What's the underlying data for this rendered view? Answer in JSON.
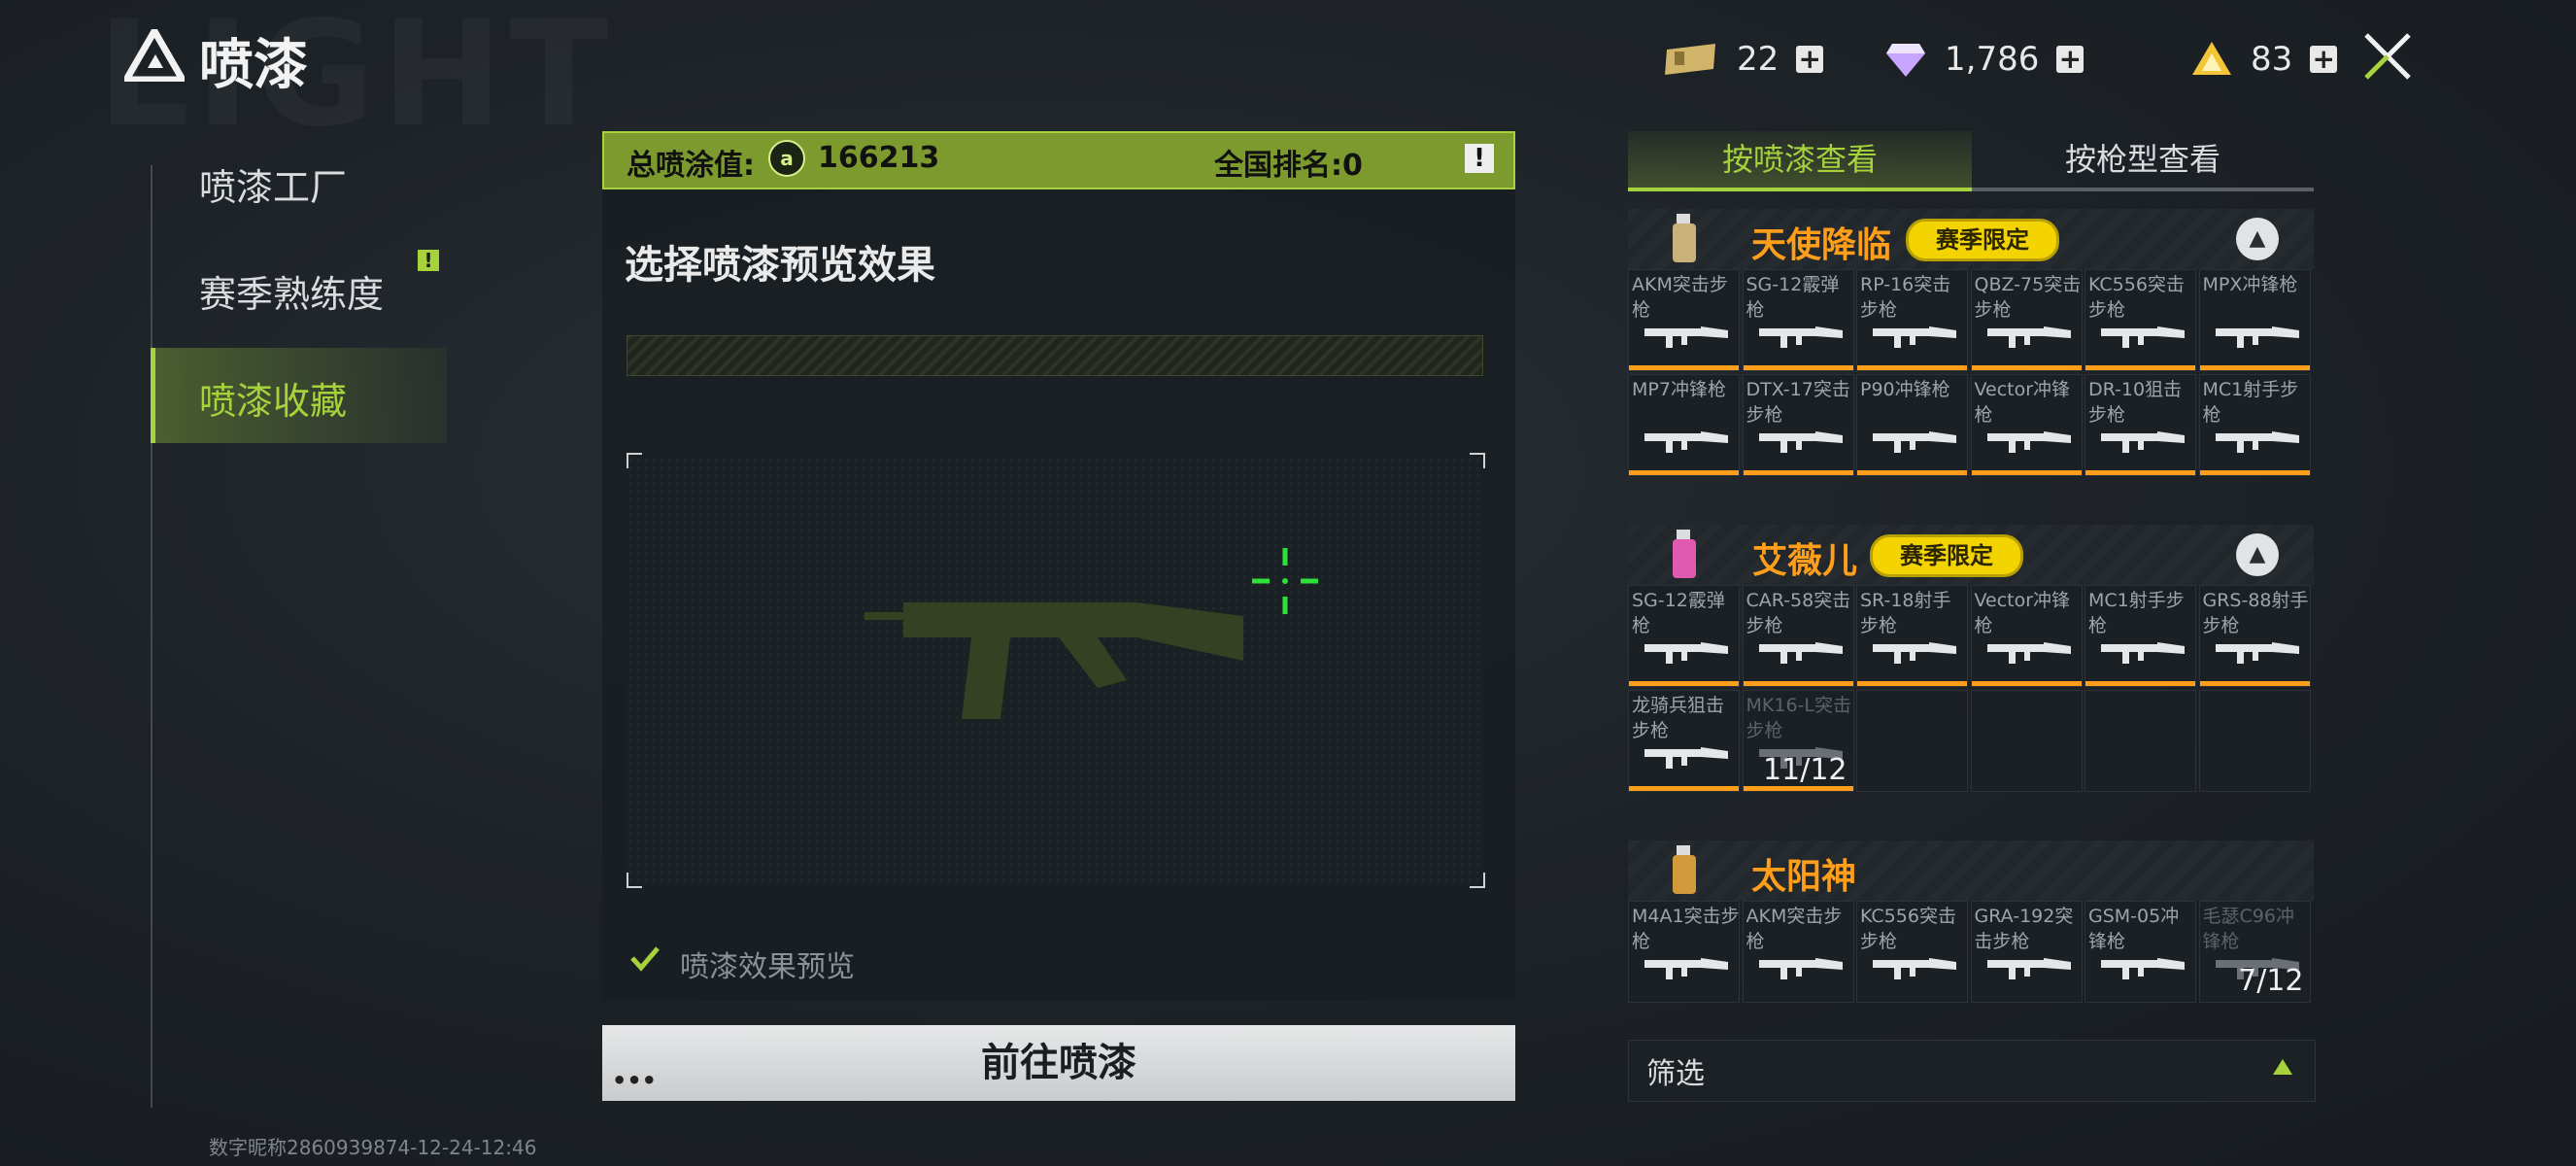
{
  "header": {
    "title": "喷漆",
    "watermark": "LIGHT",
    "currencies": [
      {
        "icon": "ticket-icon",
        "value": "22"
      },
      {
        "icon": "diamond-icon",
        "value": "1,786"
      },
      {
        "icon": "triangle-coin-icon",
        "value": "83"
      }
    ]
  },
  "nav": {
    "items": [
      {
        "label": "喷漆工厂"
      },
      {
        "label": "赛季熟练度",
        "badge": "!"
      },
      {
        "label": "喷漆收藏",
        "active": true
      }
    ]
  },
  "footer": {
    "text": "数字昵称2860939874-12-24-12:46"
  },
  "mid": {
    "header_label": "总喷涂值:",
    "total_value": "166213",
    "rank_label": "全国排名:0",
    "info": "!",
    "title": "选择喷漆预览效果",
    "checkbox_label": "喷漆效果预览",
    "go_button": "前往喷漆",
    "go_dots": "•••"
  },
  "right": {
    "tabs": [
      {
        "label": "按喷漆查看",
        "active": true
      },
      {
        "label": "按枪型查看",
        "active": false
      }
    ],
    "groups": [
      {
        "name": "天使降临",
        "badge": "赛季限定",
        "collapse": "▲",
        "rows": [
          [
            {
              "name": "AKM突击步枪"
            },
            {
              "name": "SG-12霰弹枪"
            },
            {
              "name": "RP-16突击步枪"
            },
            {
              "name": "QBZ-75突击步枪"
            },
            {
              "name": "KC556突击步枪"
            },
            {
              "name": "MPX冲锋枪"
            }
          ],
          [
            {
              "name": "MP7冲锋枪"
            },
            {
              "name": "DTX-17突击步枪"
            },
            {
              "name": "P90冲锋枪"
            },
            {
              "name": "Vector冲锋枪"
            },
            {
              "name": "DR-10狙击步枪"
            },
            {
              "name": "MC1射手步枪"
            }
          ]
        ]
      },
      {
        "name": "艾薇儿",
        "badge": "赛季限定",
        "collapse": "▲",
        "rows": [
          [
            {
              "name": "SG-12霰弹枪"
            },
            {
              "name": "CAR-58突击步枪"
            },
            {
              "name": "SR-18射手步枪"
            },
            {
              "name": "Vector冲锋枪"
            },
            {
              "name": "MC1射手步枪"
            },
            {
              "name": "GRS-88射手步枪"
            }
          ],
          [
            {
              "name": "龙骑兵狙击步枪"
            },
            {
              "name": "MK16-L突击步枪",
              "dim": true,
              "count": "11/12"
            }
          ]
        ]
      },
      {
        "name": "太阳神",
        "rows": [
          [
            {
              "name": "M4A1突击步枪"
            },
            {
              "name": "AKM突击步枪"
            },
            {
              "name": "KC556突击步枪"
            },
            {
              "name": "GRA-192突击步枪"
            },
            {
              "name": "GSM-05冲锋枪"
            },
            {
              "name": "毛瑟C96冲锋枪",
              "dim": true,
              "count": "7/12"
            }
          ]
        ]
      }
    ],
    "filter_label": "筛选"
  },
  "colors": {
    "accent": "#a6d23c",
    "orange": "#ff9e1a",
    "badge_yellow": "#f4d400"
  }
}
